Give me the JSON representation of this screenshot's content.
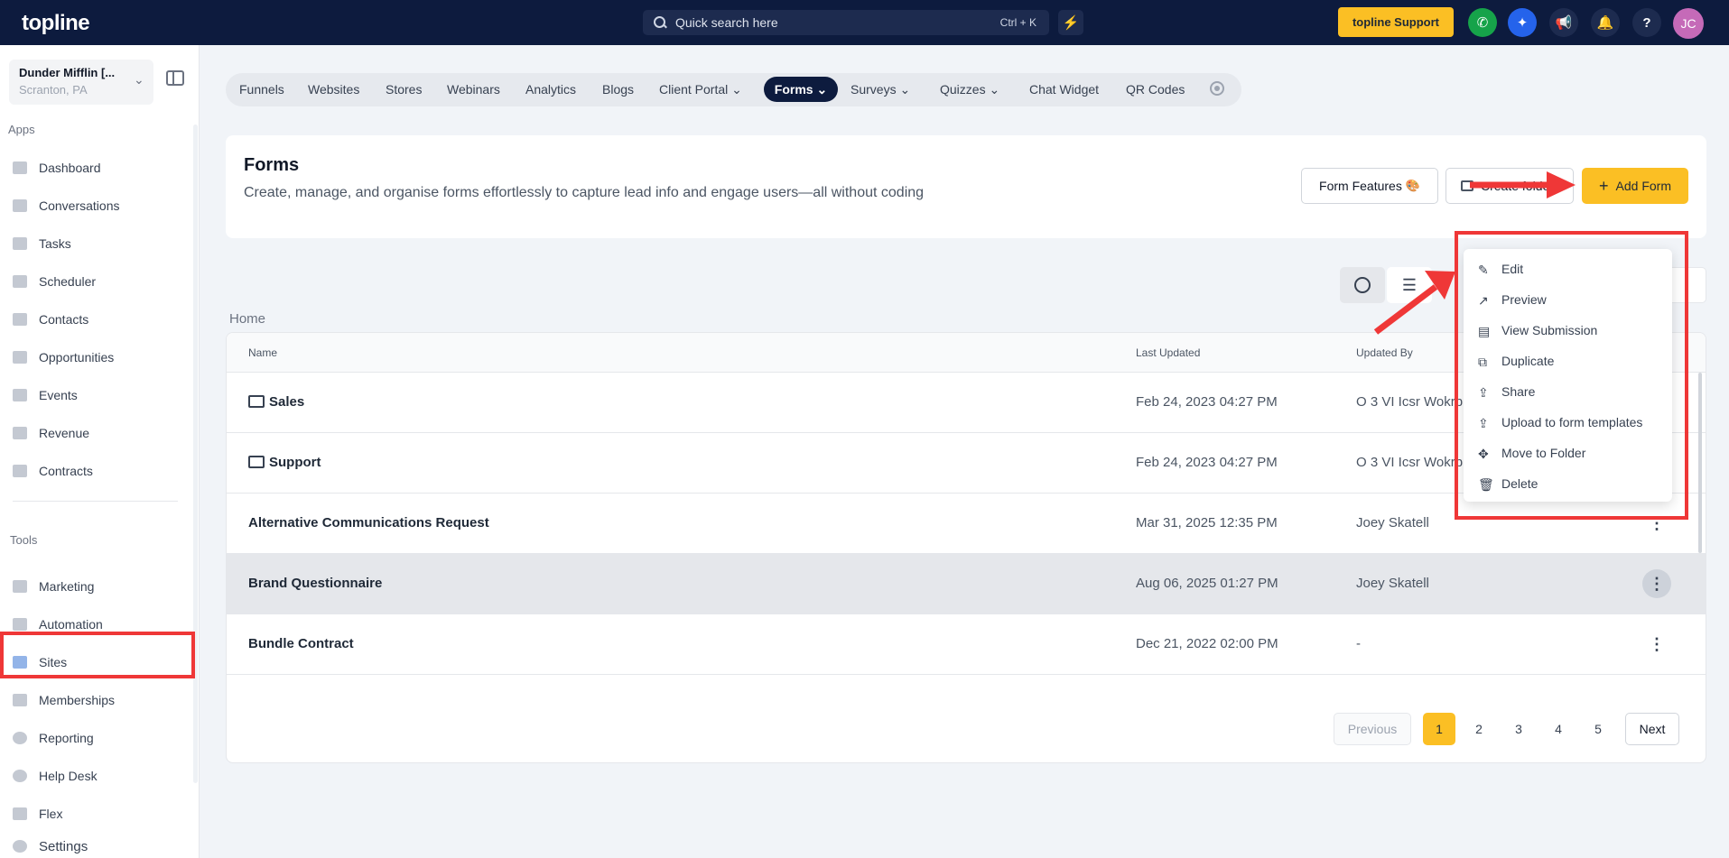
{
  "topbar": {
    "logo": "topline",
    "search_placeholder": "Quick search here",
    "search_shortcut": "Ctrl + K",
    "support_label": "topline Support",
    "avatar_initials": "JC"
  },
  "sidebar": {
    "account_name": "Dunder Mifflin [...",
    "account_location": "Scranton, PA",
    "apps_label": "Apps",
    "apps": [
      "Dashboard",
      "Conversations",
      "Tasks",
      "Scheduler",
      "Contacts",
      "Opportunities",
      "Events",
      "Revenue",
      "Contracts"
    ],
    "tools_label": "Tools",
    "tools": [
      "Marketing",
      "Automation",
      "Sites",
      "Memberships",
      "Reporting",
      "Help Desk",
      "Flex"
    ],
    "settings_label": "Settings"
  },
  "tabs": [
    "Funnels",
    "Websites",
    "Stores",
    "Webinars",
    "Analytics",
    "Blogs",
    "Client Portal",
    "Forms",
    "Surveys",
    "Quizzes",
    "Chat Widget",
    "QR Codes"
  ],
  "header": {
    "title": "Forms",
    "description": "Create, manage, and organise forms effortlessly to capture lead info and engage users—all without coding",
    "form_features_label": "Form Features",
    "create_folder_label": "Create folder",
    "add_form_label": "Add Form"
  },
  "breadcrumb": "Home",
  "table": {
    "columns": [
      "Name",
      "Last Updated",
      "Updated By"
    ],
    "rows": [
      {
        "name": "Sales",
        "updated": "Feb 24, 2023 04:27 PM",
        "by": "O 3 VI Icsr Wokrp"
      },
      {
        "name": "Support",
        "updated": "Feb 24, 2023 04:27 PM",
        "by": "O 3 VI Icsr Wokrp"
      },
      {
        "name": "Alternative Communications Request",
        "updated": "Mar 31, 2025 12:35 PM",
        "by": "Joey Skatell"
      },
      {
        "name": "Brand Questionnaire",
        "updated": "Aug 06, 2025 01:27 PM",
        "by": "Joey Skatell"
      },
      {
        "name": "Bundle Contract",
        "updated": "Dec 21, 2022 02:00 PM",
        "by": "-"
      }
    ]
  },
  "pagination": {
    "previous": "Previous",
    "pages": [
      "1",
      "2",
      "3",
      "4",
      "5"
    ],
    "current": "1",
    "next": "Next"
  },
  "menu": [
    "Edit",
    "Preview",
    "View Submission",
    "Duplicate",
    "Share",
    "Upload to form templates",
    "Move to Folder",
    "Delete"
  ],
  "colors": {
    "navy": "#0d1b3e",
    "accent": "#fbbf24",
    "annotation": "#ef3737"
  }
}
